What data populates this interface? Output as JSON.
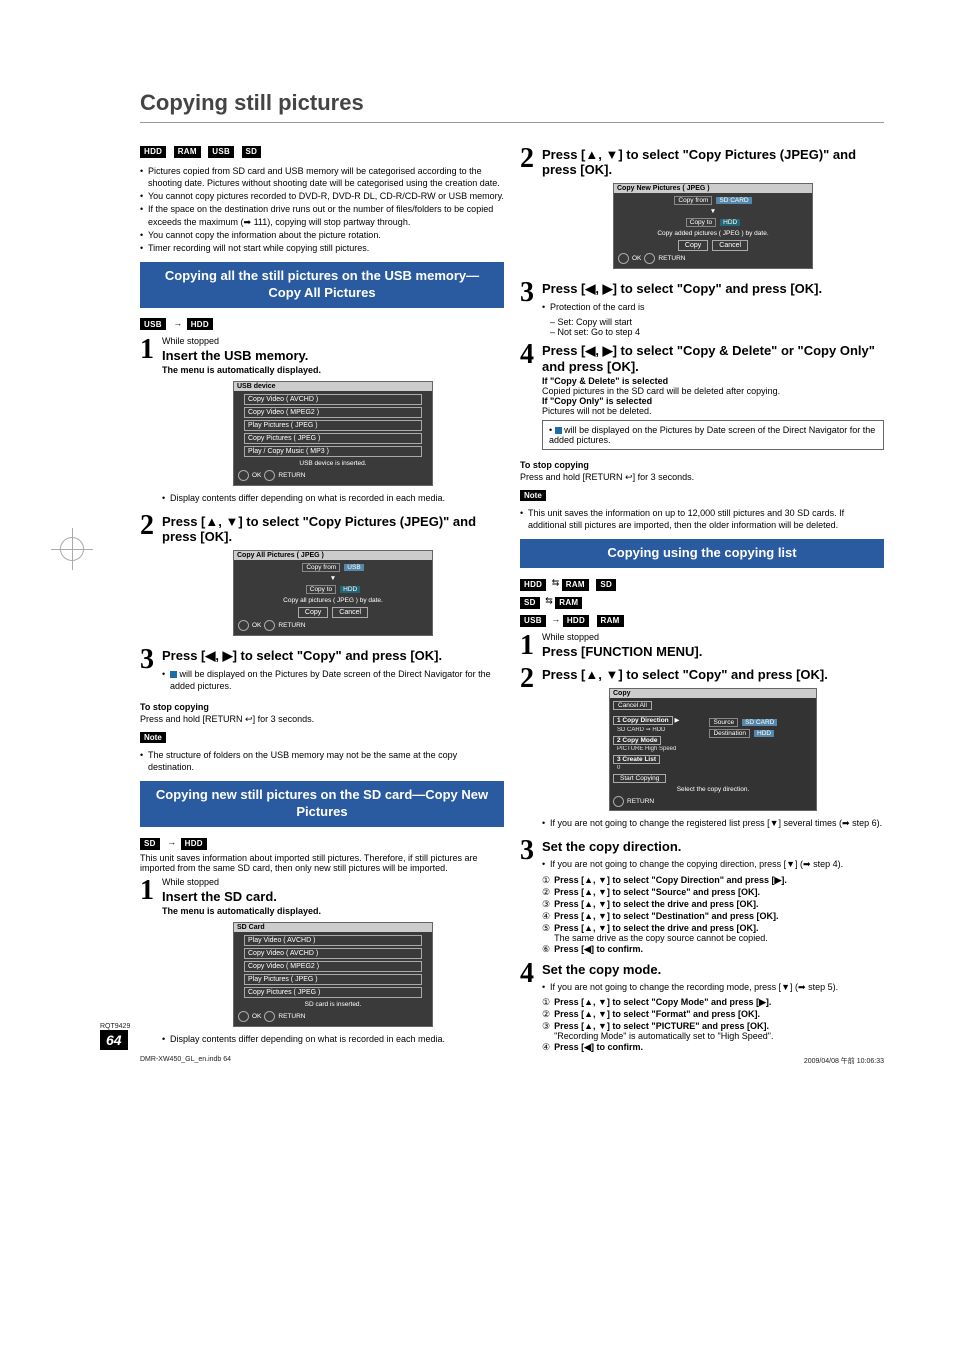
{
  "title": "Copying still pictures",
  "chips": {
    "hdd": "HDD",
    "ram": "RAM",
    "usb": "USB",
    "sd": "SD"
  },
  "left": {
    "intro": [
      "Pictures copied from SD card and USB memory will be categorised according to the shooting date. Pictures without shooting date will be categorised using the creation date.",
      "You cannot copy pictures recorded to DVD-R, DVD-R DL, CD-R/CD-RW or USB memory.",
      "If the space on the destination drive runs out or the number of files/folders to be copied exceeds the maximum (➡ 111), copying will stop partway through.",
      "You cannot copy the information about the picture rotation.",
      "Timer recording will not start while copying still pictures."
    ],
    "sec1": {
      "header": "Copying all the still pictures on the USB memory—Copy All Pictures",
      "s1_l1": "While stopped",
      "s1_l2": "Insert the USB memory.",
      "s1_l3": "The menu is automatically displayed.",
      "panel1": {
        "title": "USB device",
        "items": [
          "Copy Video ( AVCHD )",
          "Copy Video ( MPEG2 )",
          "Play Pictures ( JPEG )",
          "Copy Pictures ( JPEG )",
          "Play / Copy Music ( MP3 )"
        ],
        "hint": "USB device is inserted.",
        "ok": "OK",
        "ret": "RETURN"
      },
      "s1_after": "Display contents differ depending on what is recorded in each media.",
      "s2": "Press [▲, ▼] to select \"Copy Pictures (JPEG)\" and press [OK].",
      "panel2": {
        "title": "Copy All Pictures ( JPEG )",
        "from": "Copy from",
        "from_v": "USB",
        "to": "Copy to",
        "to_v": "HDD",
        "mid": "Copy all pictures ( JPEG ) by date.",
        "btn_copy": "Copy",
        "btn_cancel": "Cancel",
        "ok": "OK",
        "ret": "RETURN"
      },
      "s3": "Press [◀, ▶] to select \"Copy\" and press [OK].",
      "s3_note": " will be displayed on the Pictures by Date screen of the Direct Navigator for the added pictures.",
      "stop_h": "To stop copying",
      "stop_b": "Press and hold [RETURN ↩] for 3 seconds.",
      "note": "The structure of folders on the USB memory may not be the same at the copy destination."
    },
    "sec2": {
      "header": "Copying new still pictures on the SD card—Copy New Pictures",
      "intro": "This unit saves information about imported still pictures. Therefore, if still pictures are imported from the same SD card, then only new still pictures will be imported.",
      "s1_l1": "While stopped",
      "s1_l2": "Insert the SD card.",
      "s1_l3": "The menu is automatically displayed.",
      "panel": {
        "title": "SD Card",
        "items": [
          "Play Video ( AVCHD )",
          "Copy Video ( AVCHD )",
          "Copy Video ( MPEG2 )",
          "Play Pictures ( JPEG )",
          "Copy Pictures ( JPEG )"
        ],
        "hint": "SD card is inserted.",
        "ok": "OK",
        "ret": "RETURN"
      },
      "after": "Display contents differ depending on what is recorded in each media."
    }
  },
  "right": {
    "s2": "Press [▲, ▼] to select \"Copy Pictures (JPEG)\" and press [OK].",
    "panel2b": {
      "title": "Copy New Pictures ( JPEG )",
      "from": "Copy from",
      "from_v": "SD CARD",
      "to": "Copy to",
      "to_v": "HDD",
      "mid": "Copy added pictures ( JPEG ) by date.",
      "btn_copy": "Copy",
      "btn_cancel": "Cancel",
      "ok": "OK",
      "ret": "RETURN"
    },
    "s3": "Press [◀, ▶] to select \"Copy\" and press [OK].",
    "s3_b": [
      "Protection of the card is",
      "– Set: Copy will start",
      "– Not set: Go to step 4"
    ],
    "s4": "Press [◀, ▶] to select \"Copy & Delete\" or \"Copy Only\" and press [OK].",
    "s4_b1": "If \"Copy & Delete\" is selected",
    "s4_b1t": "Copied pictures in the SD card will be deleted after copying.",
    "s4_b2": "If \"Copy Only\" is selected",
    "s4_b2t": "Pictures will not be deleted.",
    "s4_box": " will be displayed on the Pictures by Date screen of the Direct Navigator for the added pictures.",
    "stop_h": "To stop copying",
    "stop_b": "Press and hold [RETURN ↩] for 3 seconds.",
    "note": "This unit saves the information on up to 12,000 still pictures and 30 SD cards. If additional still pictures are imported, then the older information will be deleted.",
    "sec3": {
      "header": "Copying using the copying list",
      "s1_l1": "While stopped",
      "s1_l2": "Press [FUNCTION MENU].",
      "s2": "Press [▲, ▼] to select \"Copy\" and press [OK].",
      "copyui": {
        "title": "Copy",
        "cancel": "Cancel All",
        "i1": "Copy Direction",
        "i1s": "SD CARD ➞ HDD",
        "i2": "Copy Mode",
        "i2s": "PICTURE  High Speed",
        "i3": "Create List",
        "i3s": "0",
        "src": "Source",
        "src_v": "SD CARD",
        "dst": "Destination",
        "dst_v": "HDD",
        "start": "Start Copying",
        "hint": "Select the copy direction.",
        "ret": "RETURN"
      },
      "s2_after": "If you are not going to change the registered list press [▼] several times (➡ step 6).",
      "s3": "Set the copy direction.",
      "s3_pre": "If you are not going to change the copying direction, press [▼] (➡ step 4).",
      "s3_items": [
        "Press [▲, ▼] to select \"Copy Direction\" and press [▶].",
        "Press [▲, ▼] to select \"Source\" and press [OK].",
        "Press [▲, ▼] to select the drive and press [OK].",
        "Press [▲, ▼] to select \"Destination\" and press [OK].",
        "Press [▲, ▼] to select the drive and press [OK].",
        "Press [◀] to confirm."
      ],
      "s3_same": "The same drive as the copy source cannot be copied.",
      "s4": "Set the copy mode.",
      "s4_pre": "If you are not going to change the recording mode, press [▼] (➡ step 5).",
      "s4_items": [
        "Press [▲, ▼] to select \"Copy Mode\" and press [▶].",
        "Press [▲, ▼] to select \"Format\" and press [OK].",
        "Press [▲, ▼] to select \"PICTURE\" and press [OK].",
        "Press [◀] to confirm."
      ],
      "s4_auto": "\"Recording Mode\" is automatically set to \"High Speed\"."
    }
  },
  "footer": {
    "id": "RQT9429",
    "page": "64",
    "fl": "DMR-XW450_GL_en.indb   64",
    "fr": "2009/04/08   午前 10:06:33"
  },
  "labels": {
    "note": "Note"
  }
}
